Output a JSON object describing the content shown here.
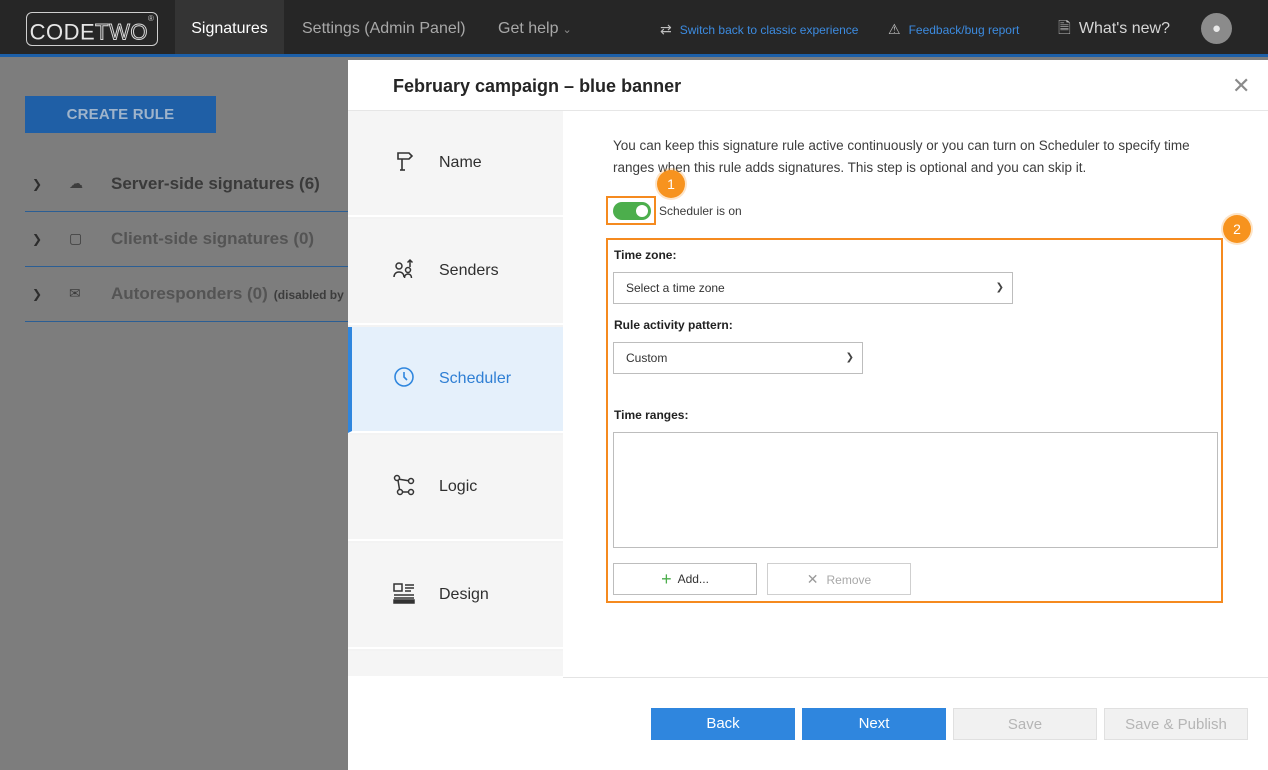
{
  "topbar": {
    "logo_main": "CODE",
    "logo_accent": "TWO",
    "logo_mark": "®",
    "tabs": [
      {
        "label": "Signatures"
      },
      {
        "label": "Settings (Admin Panel)"
      },
      {
        "label": "Get help"
      }
    ],
    "classic_link": "Switch back to classic experience",
    "feedback_link": "Feedback/bug report",
    "whats_new": "What's new?"
  },
  "left_panel": {
    "create_rule": "CREATE RULE",
    "rows": [
      {
        "label": "Server-side signatures (6)",
        "icon": "cloud-icon"
      },
      {
        "label": "Client-side signatures (0)",
        "icon": "monitor-icon"
      },
      {
        "label": "Autoresponders (0)",
        "sub": "(disabled by",
        "icon": "autoresponder-icon"
      }
    ]
  },
  "modal": {
    "title": "February campaign – blue banner",
    "steps": [
      {
        "label": "Name",
        "icon": "signpost-icon"
      },
      {
        "label": "Senders",
        "icon": "senders-icon"
      },
      {
        "label": "Scheduler",
        "icon": "clock-icon",
        "active": true
      },
      {
        "label": "Logic",
        "icon": "logic-icon"
      },
      {
        "label": "Design",
        "icon": "design-icon"
      }
    ],
    "description": "You can keep this signature rule active continuously or you can turn on Scheduler to specify time ranges when this rule adds signatures. This step is optional and you can skip it.",
    "scheduler_toggle_label": "Scheduler is on",
    "scheduler_on": true,
    "callouts": [
      "1",
      "2"
    ],
    "timezone_label": "Time zone:",
    "timezone_value": "Select a time zone",
    "pattern_label": "Rule activity pattern:",
    "pattern_value": "Custom",
    "time_ranges_label": "Time ranges:",
    "add_label": "Add...",
    "remove_label": "Remove",
    "buttons": {
      "back": "Back",
      "next": "Next",
      "save": "Save",
      "save_publish": "Save & Publish"
    }
  },
  "colors": {
    "accent": "#2f86de",
    "highlight": "#f58a1f",
    "toggle_on": "#4cae4c",
    "topbar": "#262626"
  }
}
